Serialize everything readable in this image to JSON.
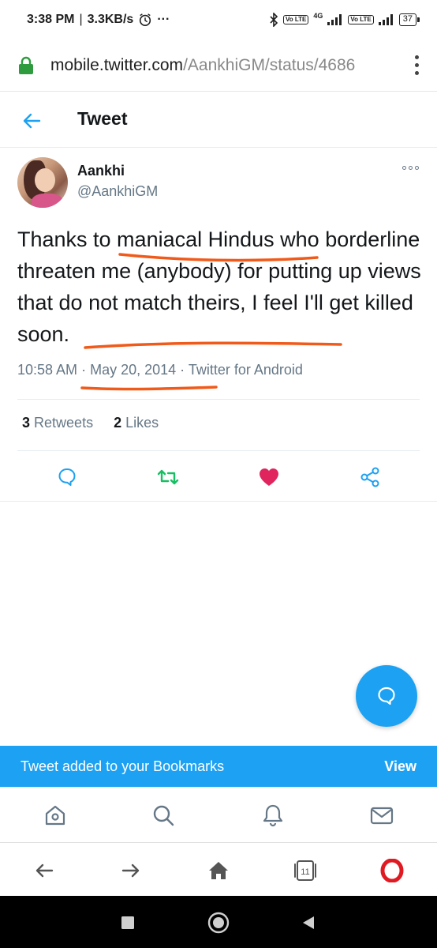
{
  "status_bar": {
    "time": "3:38 PM",
    "speed": "3.3KB/s",
    "dots": "···",
    "network": "4G",
    "lte_badge": "Vo LTE",
    "battery": "37"
  },
  "browser": {
    "url_host": "mobile.twitter.com",
    "url_path": "/AankhiGM/status/4686",
    "tabs_count": "11"
  },
  "header": {
    "title": "Tweet"
  },
  "tweet": {
    "display_name": "Aankhi",
    "handle": "@AankhiGM",
    "text": "Thanks to maniacal Hindus who borderline threaten me (anybody) for putting up views that do not match theirs, I feel I'll get killed soon.",
    "time": "10:58 AM",
    "date": "May 20, 2014",
    "source": "Twitter for Android",
    "retweets_count": "3",
    "retweets_label": "Retweets",
    "likes_count": "2",
    "likes_label": "Likes"
  },
  "toast": {
    "message": "Tweet added to your Bookmarks",
    "action": "View"
  },
  "icons": {
    "back": "arrow-left-icon",
    "reply": "comment-icon",
    "retweet": "retweet-icon",
    "like": "heart-icon",
    "share": "share-icon",
    "compose": "compose-icon",
    "home": "home-icon",
    "search": "search-icon",
    "notifications": "bell-icon",
    "messages": "mail-icon"
  },
  "colors": {
    "accent": "#1da1f2",
    "retweet_green": "#17bf63",
    "like_red": "#e0245e",
    "annotation_orange": "#f05a1a",
    "lock_green": "#2e9b3f",
    "opera_red": "#e01a22"
  }
}
